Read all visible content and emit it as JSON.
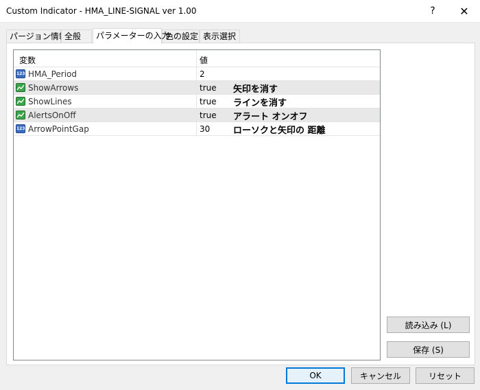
{
  "window": {
    "title": "Custom Indicator - HMA_LINE-SIGNAL ver 1.00",
    "help_glyph": "?",
    "close_glyph": "✕"
  },
  "tabs": [
    {
      "label": "パージョン情報"
    },
    {
      "label": "全般"
    },
    {
      "label": "パラメーターの入力",
      "active": true
    },
    {
      "label": "色の設定"
    },
    {
      "label": "表示選択"
    }
  ],
  "grid": {
    "columns": [
      "変数",
      "値"
    ],
    "rows": [
      {
        "icon": "numeric-icon",
        "icon_text": "123",
        "name": "HMA_Period",
        "value": "2",
        "note": ""
      },
      {
        "icon": "boolean-icon",
        "name": "ShowArrows",
        "value": "true",
        "note": "矢印を消す"
      },
      {
        "icon": "boolean-icon",
        "name": "ShowLines",
        "value": "true",
        "note": "ラインを消す"
      },
      {
        "icon": "boolean-icon",
        "name": "AlertsOnOff",
        "value": "true",
        "note": "アラート オンオフ"
      },
      {
        "icon": "numeric-icon",
        "icon_text": "123",
        "name": "ArrowPointGap",
        "value": "30",
        "note": "ローソクと矢印の 距離"
      }
    ]
  },
  "side_buttons": {
    "load": "読み込み (L)",
    "save": "保存 (S)"
  },
  "footer_buttons": {
    "ok": "OK",
    "cancel": "キャンセル",
    "reset": "リセット"
  },
  "colors": {
    "accent": "#0078d7",
    "numeric_icon": "#3b6fc2",
    "boolean_icon": "#3aa54a"
  }
}
